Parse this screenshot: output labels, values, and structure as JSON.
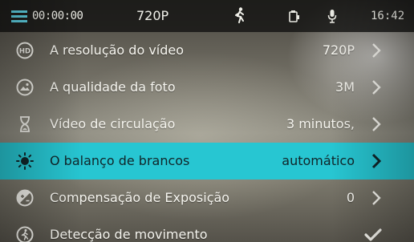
{
  "status_bar": {
    "elapsed": "00:00:00",
    "resolution": "720P",
    "clock": "16:42",
    "icons": [
      "menu-icon",
      "motion-detect-icon",
      "camera-icon",
      "microphone-icon"
    ]
  },
  "menu": {
    "items": [
      {
        "icon": "hd-icon",
        "label": "A resolução do vídeo",
        "value": "720P",
        "control": "chevron"
      },
      {
        "icon": "photo-quality-icon",
        "label": "A qualidade da foto",
        "value": "3M",
        "control": "chevron"
      },
      {
        "icon": "hourglass-icon",
        "label": "Vídeo de circulação",
        "value": "3 minutos,",
        "control": "chevron"
      },
      {
        "icon": "sun-icon",
        "label": "O balanço de brancos",
        "value": "automático",
        "control": "chevron",
        "selected": true
      },
      {
        "icon": "exposure-icon",
        "label": "Compensação de Exposição",
        "value": "0",
        "control": "chevron"
      },
      {
        "icon": "motion-detect-icon",
        "label": "Detecção de movimento",
        "value": "",
        "control": "checkmark"
      }
    ]
  },
  "colors": {
    "selection": "#27c6d2",
    "statusbar": "#141412",
    "accent_icon": "#5fd3e5"
  }
}
